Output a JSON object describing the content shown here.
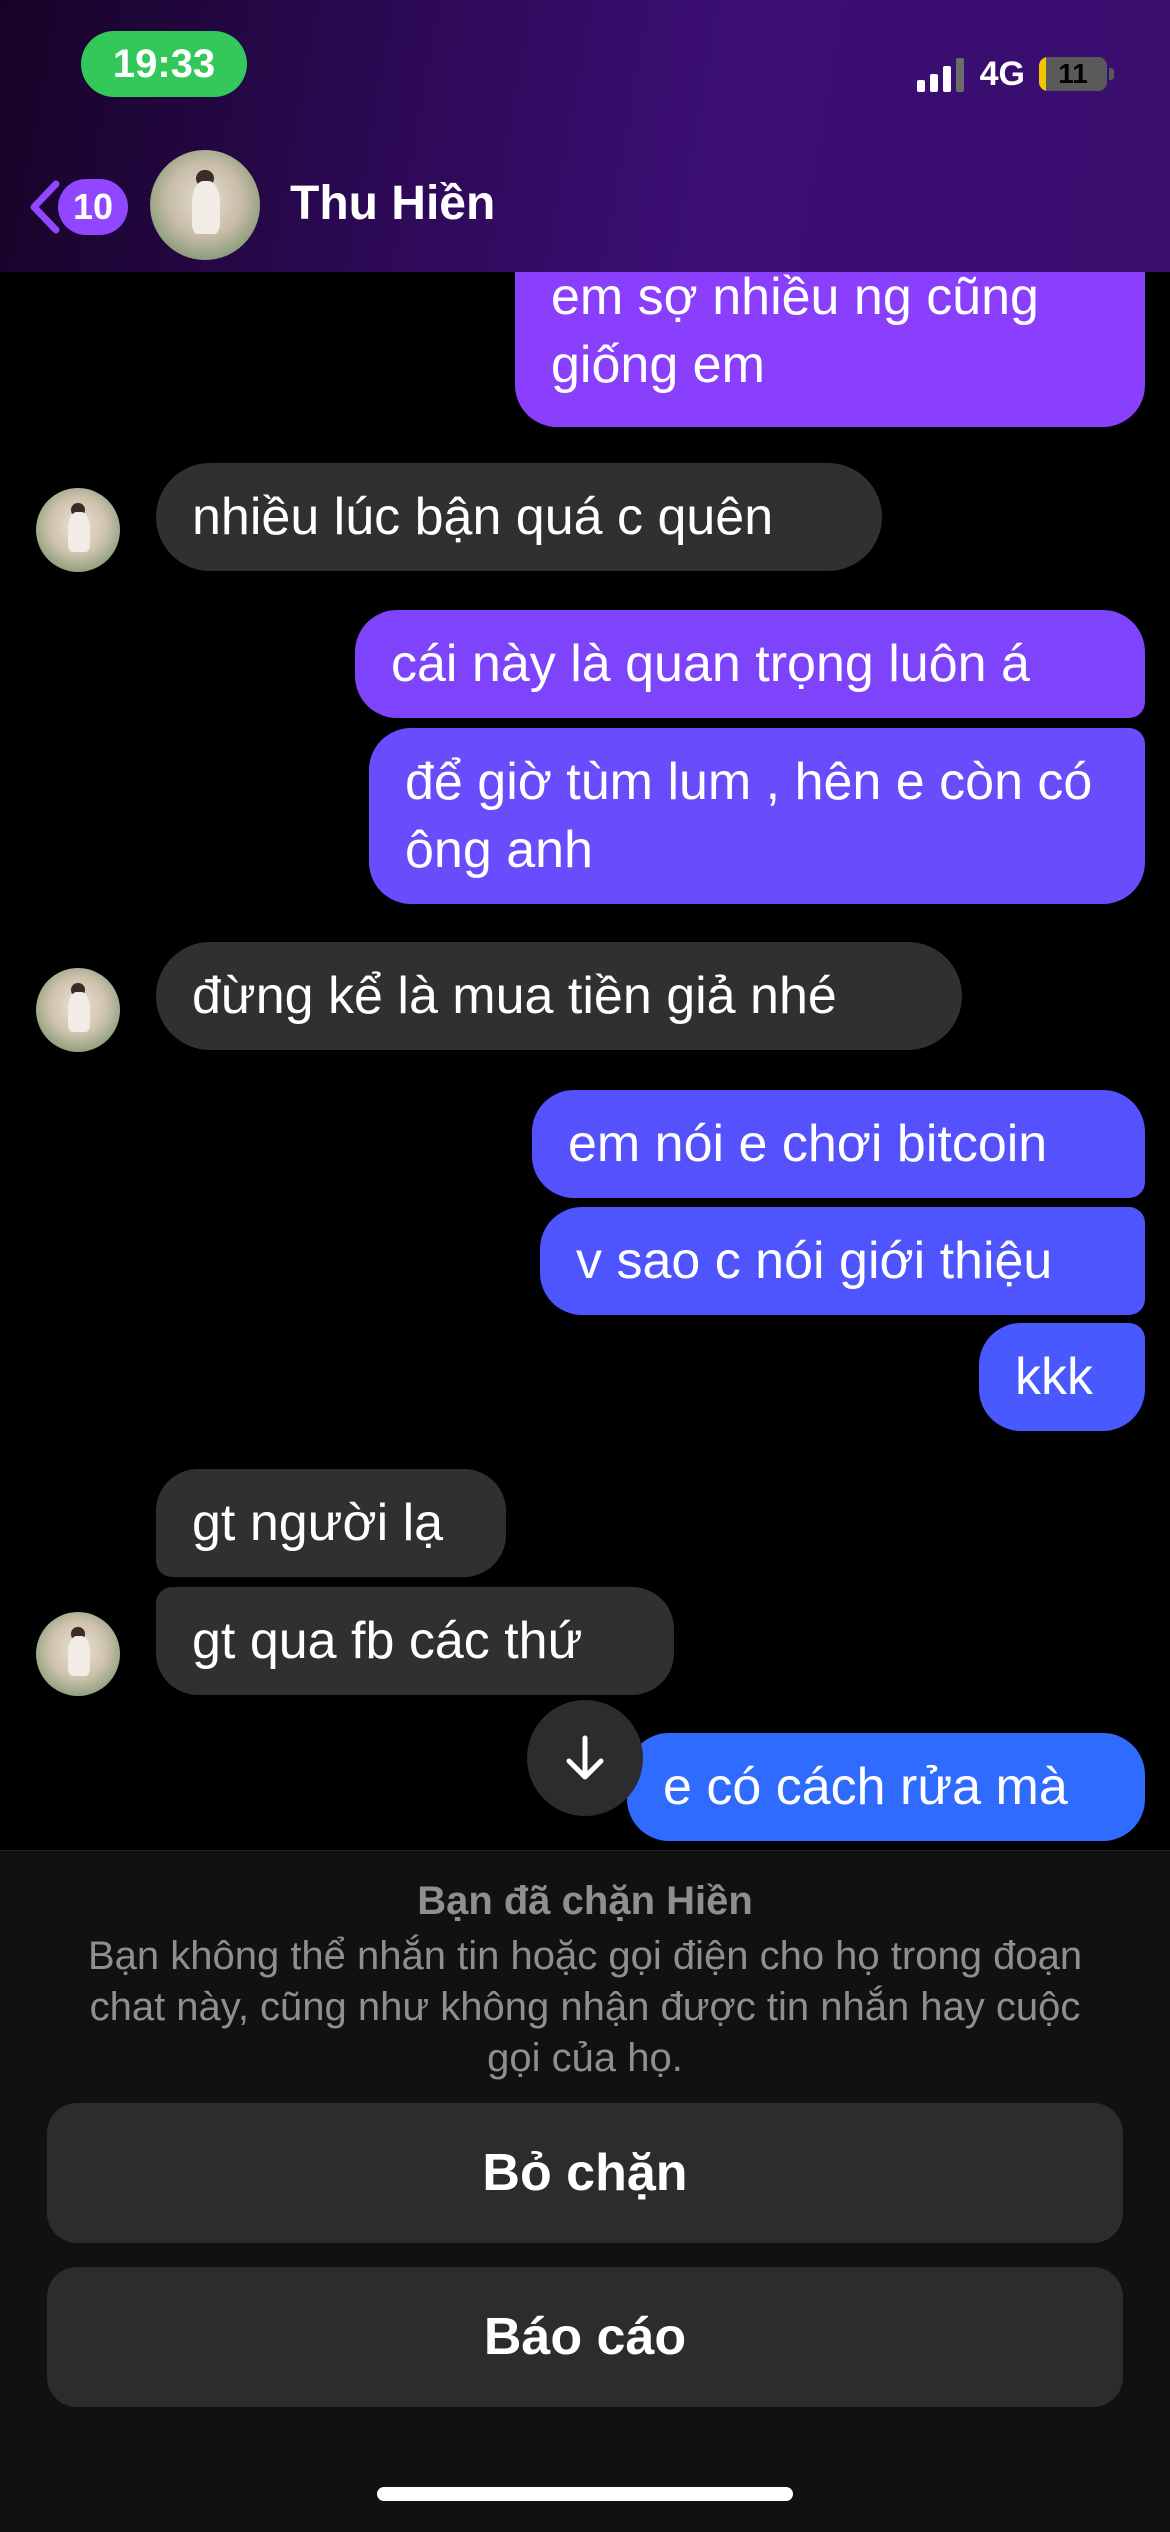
{
  "status_bar": {
    "time": "19:33",
    "network": "4G",
    "battery": "11",
    "battery_level_percent": 11,
    "signal_bars": 3
  },
  "header": {
    "back_badge": "10",
    "contact_name": "Thu Hiền"
  },
  "colors": {
    "time_pill": "#34c759",
    "accent_purple": "#9146ff",
    "incoming_bubble": "#303030",
    "outgoing_top": "#8a3ffc",
    "outgoing_bottom": "#2f6bff"
  },
  "messages": [
    {
      "dir": "out",
      "text": "em sợ nhiều ng cũng giống em"
    },
    {
      "dir": "in",
      "text": "nhiều lúc bận quá c quên"
    },
    {
      "dir": "out",
      "text": "cái này là quan trọng luôn á"
    },
    {
      "dir": "out",
      "text": "để giờ tùm lum , hên e còn có ông anh"
    },
    {
      "dir": "in",
      "text": "đừng kể là mua tiền  giả nhé"
    },
    {
      "dir": "out",
      "text": "em nói e chơi bitcoin"
    },
    {
      "dir": "out",
      "text": "v sao c nói giới thiệu"
    },
    {
      "dir": "out",
      "text": "kkk"
    },
    {
      "dir": "in",
      "text": "gt người lạ"
    },
    {
      "dir": "in",
      "text": "gt qua fb các thứ"
    },
    {
      "dir": "out",
      "text": "e có cách rửa mà"
    }
  ],
  "blocked_panel": {
    "title": "Bạn đã chặn Hiền",
    "description": "Bạn không thể nhắn tin hoặc gọi điện cho họ trong đoạn chat này, cũng như không nhận được tin nhắn hay cuộc gọi của họ.",
    "unblock_label": "Bỏ chặn",
    "report_label": "Báo cáo"
  },
  "icons": {
    "back": "chevron-left-icon",
    "scroll_down": "arrow-down-icon",
    "avatar": "contact-avatar"
  }
}
